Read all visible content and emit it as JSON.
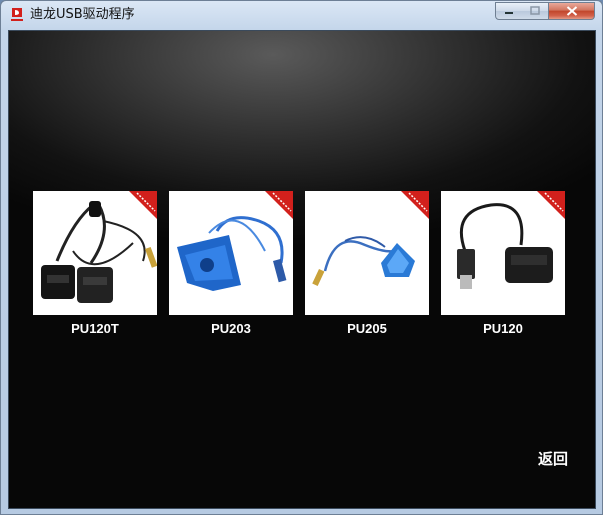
{
  "window": {
    "title": "迪龙USB驱动程序"
  },
  "products": [
    {
      "name": "PU120T",
      "image": "dual-ps2-adapter-twin"
    },
    {
      "name": "PU203",
      "image": "dual-ps2-adapter-blue"
    },
    {
      "name": "PU205",
      "image": "dual-ps2-adapter-blue-small"
    },
    {
      "name": "PU120",
      "image": "single-ps2-adapter"
    }
  ],
  "back_label": "返回",
  "colors": {
    "accent": "#d2201c",
    "background": "#0c0c0c",
    "label": "#ffffff"
  }
}
